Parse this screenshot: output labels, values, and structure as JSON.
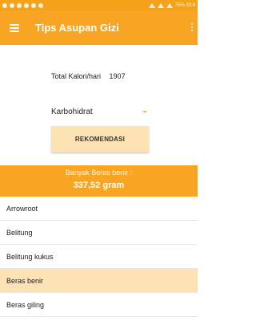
{
  "status_bar": {
    "right_text": "75% 20:4"
  },
  "app_bar": {
    "title": "Tips Asupan Gizi",
    "menu_icon": "hamburger-menu-icon",
    "overflow_icon": "overflow-menu-icon"
  },
  "calorie": {
    "label": "Total Kalori/hari",
    "value": "1907"
  },
  "nutrient_select": {
    "selected": "Karbohidrat"
  },
  "recommend_button": {
    "label": "REKOMENDASI"
  },
  "result": {
    "line1": "Banyak Beras benir :",
    "line2": "337,52 gram"
  },
  "food_list": {
    "items": [
      {
        "label": "Arrowroot",
        "selected": false
      },
      {
        "label": "Belitung",
        "selected": false
      },
      {
        "label": "Belitung kukus",
        "selected": false
      },
      {
        "label": "Beras benir",
        "selected": true
      },
      {
        "label": "Beras giling",
        "selected": false
      }
    ]
  },
  "colors": {
    "primary": "#f7a522",
    "highlight": "#fde2b4"
  }
}
